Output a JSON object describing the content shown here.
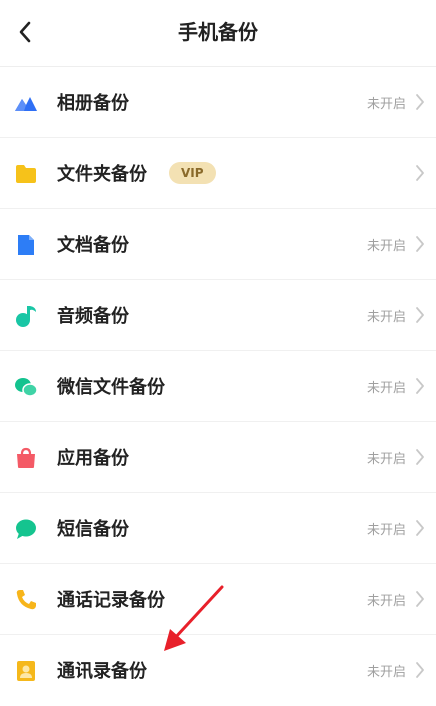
{
  "header": {
    "title": "手机备份",
    "back_icon": "chevron-left-icon"
  },
  "items": [
    {
      "label": "相册备份",
      "status": "未开启",
      "icon": "album-icon",
      "color": "#2f6ff5"
    },
    {
      "label": "文件夹备份",
      "badge": "VIP",
      "status": "",
      "icon": "folder-icon",
      "color": "#f6c21a"
    },
    {
      "label": "文档备份",
      "status": "未开启",
      "icon": "document-icon",
      "color": "#2d7df6"
    },
    {
      "label": "音频备份",
      "status": "未开启",
      "icon": "music-icon",
      "color": "#19c6a5"
    },
    {
      "label": "微信文件备份",
      "status": "未开启",
      "icon": "wechat-icon",
      "color": "#14c38f"
    },
    {
      "label": "应用备份",
      "status": "未开启",
      "icon": "app-bag-icon",
      "color": "#f45a66"
    },
    {
      "label": "短信备份",
      "status": "未开启",
      "icon": "message-icon",
      "color": "#15c48f"
    },
    {
      "label": "通话记录备份",
      "status": "未开启",
      "icon": "phone-icon",
      "color": "#f7b51b"
    },
    {
      "label": "通讯录备份",
      "status": "未开启",
      "icon": "contacts-icon",
      "color": "#f5b81b"
    }
  ],
  "annotation": {
    "icon": "red-arrow-icon",
    "color": "#e8202a"
  }
}
